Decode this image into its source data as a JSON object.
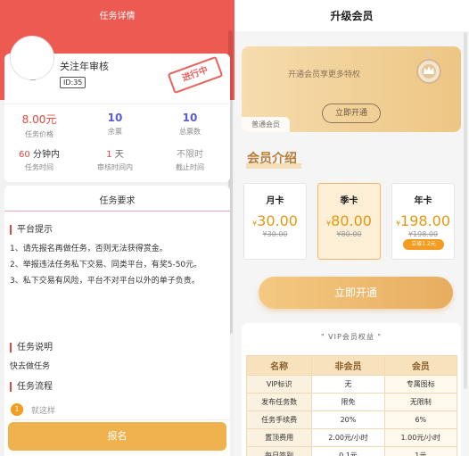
{
  "left": {
    "nav_title": "任务详情",
    "task": {
      "title": "关注年审核",
      "id": "ID:35",
      "status": "进行中"
    },
    "stats": [
      {
        "value": "8.00元",
        "label": "任务价格"
      },
      {
        "value": "10",
        "label": "余票"
      },
      {
        "value": "10",
        "label": "总票数"
      },
      {
        "value": "60",
        "unit": "分钟内",
        "label": "任务时间"
      },
      {
        "value": "1",
        "unit": "天",
        "label": "审核时间内"
      },
      {
        "value": "不限时",
        "label": "截止时间"
      }
    ],
    "requirements_title": "任务要求",
    "sections": {
      "notice_title": "平台提示",
      "notice_lines": [
        "1、请先报名再做任务，否则无法获得赏金。",
        "2、举报违法任务私下交易、同类平台，有奖5-50元。",
        "3、私下交易有风险，平台不对平台以外的单子负责。"
      ],
      "desc_title": "任务说明",
      "desc_text": "快去做任务",
      "flow_title": "任务流程",
      "flow_step_num": "1",
      "flow_step_text": "就这样"
    },
    "signup_label": "报名"
  },
  "right": {
    "page_title": "升级会员",
    "banner": {
      "text": "开通会员享更多特权",
      "button": "立即开通",
      "level": "普通会员"
    },
    "intro_title": "会员介绍",
    "plans": [
      {
        "name": "月卡",
        "currency": "¥",
        "price": "30.00",
        "original": "¥30.00"
      },
      {
        "name": "季卡",
        "currency": "¥",
        "price": "80.00",
        "original": "¥80.00"
      },
      {
        "name": "年卡",
        "currency": "¥",
        "price": "198.00",
        "original": "¥198.00",
        "badge": "立省1.2元"
      }
    ],
    "selected_plan": 1,
    "open_button": "立即开通",
    "benefits_title": "\" VIP会员权益 \"",
    "table": {
      "headers": [
        "名称",
        "非会员",
        "会员"
      ],
      "rows": [
        [
          "VIP标识",
          "无",
          "专属图标"
        ],
        [
          "发布任务数",
          "限免",
          "无限制"
        ],
        [
          "任务手续费",
          "20%",
          "6%"
        ],
        [
          "置顶费用",
          "2.00元/小时",
          "1.00元/小时"
        ],
        [
          "每日签到",
          "0.1元",
          "1元"
        ]
      ]
    }
  }
}
